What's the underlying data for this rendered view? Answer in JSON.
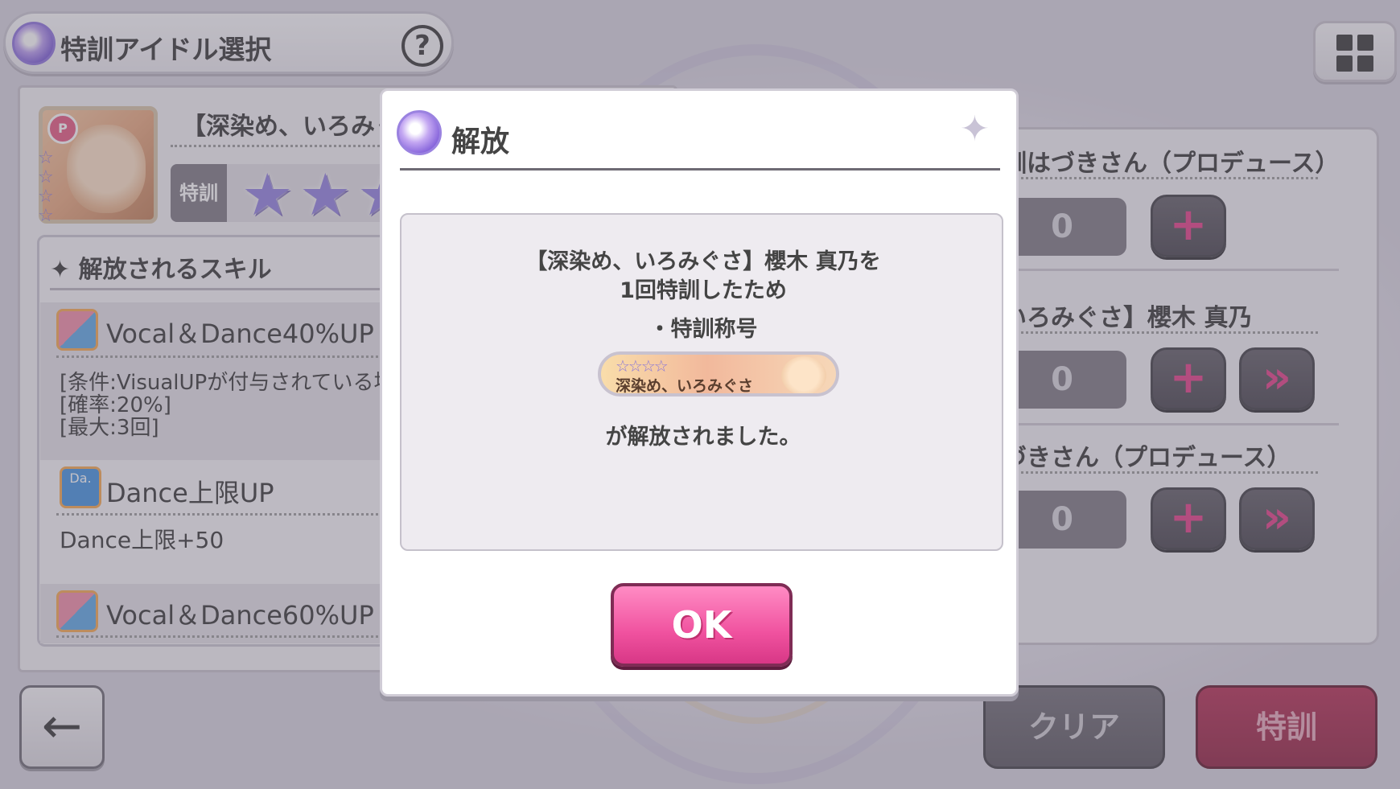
{
  "header": {
    "title": "特訓アイドル選択",
    "help_label": "?"
  },
  "idol": {
    "badge": "P",
    "name": "【深染め、いろみぐさ",
    "training_label": "特訓",
    "star_count": 4,
    "stars_shown": 3
  },
  "skills": {
    "heading": "✦ 解放されるスキル",
    "items": [
      {
        "name": "Vocal＆Dance40%UP",
        "icon": "vocal-dance-icon",
        "desc": [
          "[条件:VisualUPが付与されている場",
          "[確率:20%]",
          "[最大:3回]"
        ]
      },
      {
        "name": "Dance上限UP",
        "icon": "dance-icon",
        "desc": [
          "Dance上限+50"
        ]
      },
      {
        "name": "Vocal＆Dance60%UP",
        "icon": "vocal-dance-icon",
        "desc": []
      }
    ]
  },
  "materials": [
    {
      "name": "訓はづきさん（プロデュース）",
      "count": "0",
      "has_ff": false
    },
    {
      "name": "いろみぐさ】櫻木 真乃",
      "count": "0",
      "has_ff": true
    },
    {
      "name": "づきさん（プロデュース）",
      "count": "0",
      "has_ff": true
    }
  ],
  "buttons": {
    "plus": "+",
    "ff": "»",
    "back": "←",
    "clear": "クリア",
    "train": "特訓"
  },
  "modal": {
    "title": "解放",
    "line1": "【深染め、いろみぐさ】櫻木 真乃を",
    "line2": "1回特訓したため",
    "bullet": "・特訓称号",
    "plate_stars": "☆☆☆☆",
    "plate_text": "深染め、いろみぐさ",
    "released": "が解放されました。",
    "ok_label": "OK"
  },
  "colors": {
    "accent_pink": "#f0529f",
    "train_red": "#8f1c3d",
    "star_purple": "#8f7ee0"
  }
}
